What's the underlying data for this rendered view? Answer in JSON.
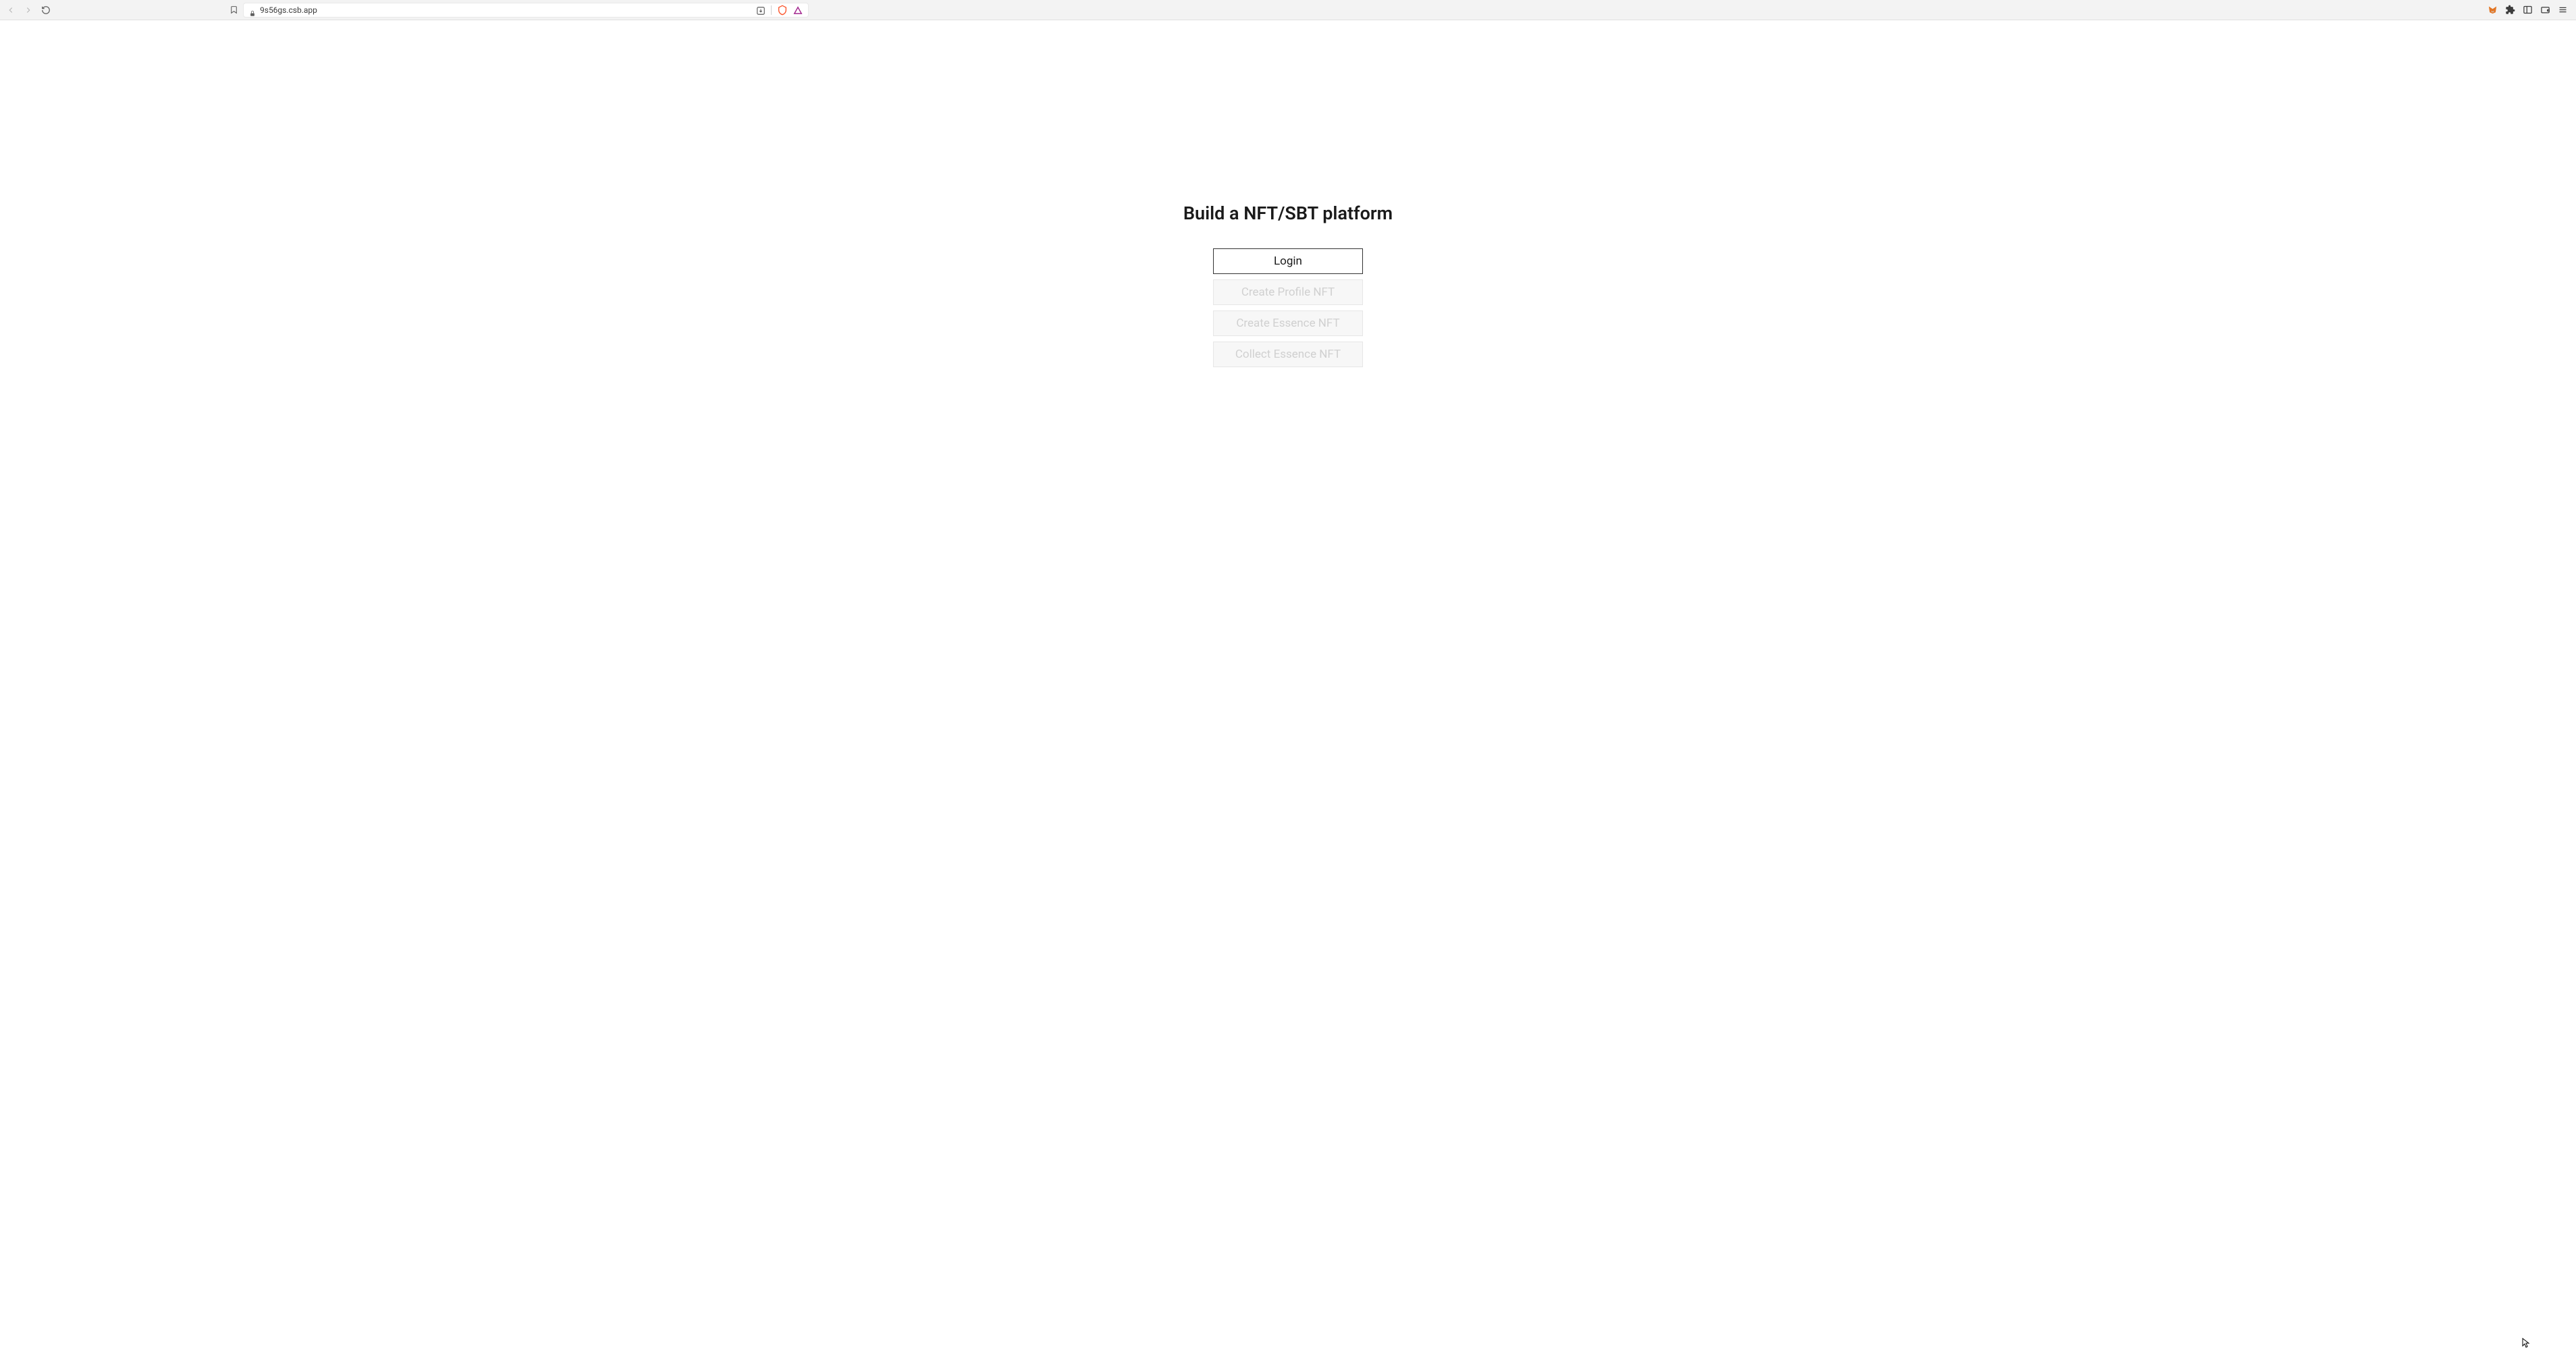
{
  "browser": {
    "url": "9s56gs.csb.app"
  },
  "page": {
    "title": "Build a NFT/SBT platform",
    "buttons": [
      {
        "label": "Login",
        "enabled": true
      },
      {
        "label": "Create Profile NFT",
        "enabled": false
      },
      {
        "label": "Create Essence NFT",
        "enabled": false
      },
      {
        "label": "Collect Essence NFT",
        "enabled": false
      }
    ]
  }
}
